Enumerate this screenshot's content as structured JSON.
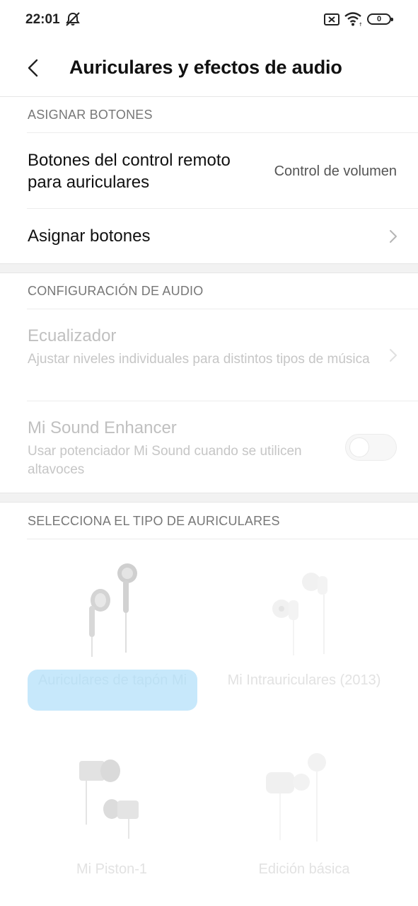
{
  "status_bar": {
    "time": "22:01",
    "battery_level": "0",
    "icons": [
      "alarm-off-icon",
      "sim-error-icon",
      "wifi-icon",
      "battery-icon"
    ]
  },
  "header": {
    "title": "Auriculares y efectos de audio",
    "back_icon": "back-chevron-icon"
  },
  "sections": {
    "assign": {
      "label": "ASIGNAR BOTONES",
      "remote_title": "Botones del control remoto para auriculares",
      "remote_value": "Control de volumen",
      "assign_title": "Asignar botones"
    },
    "audio": {
      "label": "CONFIGURACIÓN DE AUDIO",
      "eq_title": "Ecualizador",
      "eq_sub": "Ajustar niveles individuales para distintos tipos de música",
      "enhancer_title": "Mi Sound Enhancer",
      "enhancer_sub": "Usar potenciador Mi Sound cuando se utilicen altavoces",
      "enhancer_enabled": false
    },
    "headphones": {
      "label": "SELECCIONA EL TIPO DE AURICULARES",
      "items": [
        {
          "label": "Auriculares de tapón Mi",
          "selected": true
        },
        {
          "label": "Mi Intrauriculares (2013)",
          "selected": false
        },
        {
          "label": "Mi Piston-1",
          "selected": false
        },
        {
          "label": "Edición básica",
          "selected": false
        }
      ]
    }
  },
  "colors": {
    "accent_selected_bg": "#c7e8fb",
    "disabled_text": "#c0c0c0",
    "section_gap": "#f2f2f2"
  }
}
